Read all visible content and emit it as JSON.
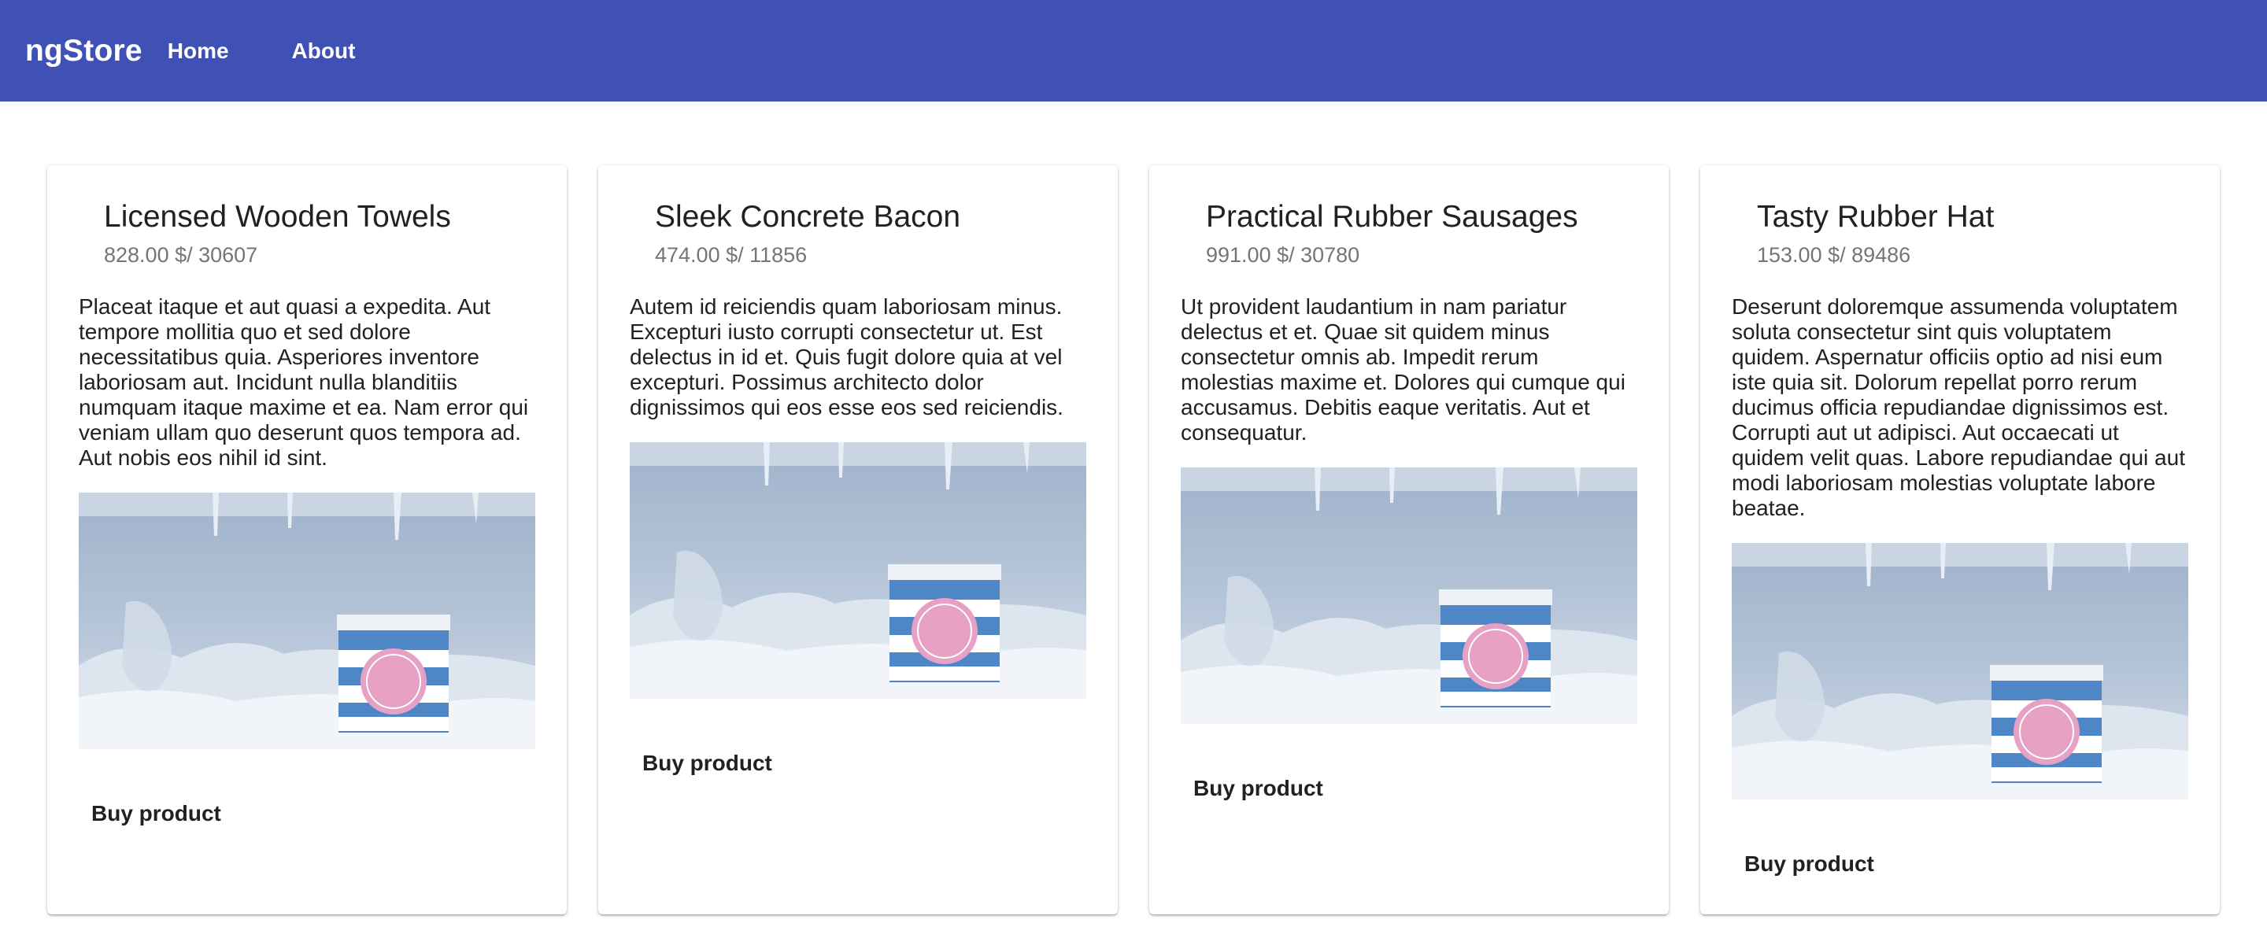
{
  "header": {
    "brand": "ngStore",
    "nav": [
      {
        "label": "Home"
      },
      {
        "label": "About"
      }
    ],
    "color": "#3f51b5"
  },
  "products": [
    {
      "title": "Licensed Wooden Towels",
      "price_line": "828.00 $/ 30607",
      "description": "Placeat itaque et aut quasi a expedita. Aut tempore mollitia quo et sed dolore necessitatibus quia. Asperiores inventore laboriosam aut. Incidunt nulla blanditiis numquam itaque maxime et ea. Nam error qui veniam ullam quo deserunt quos tempora ad. Aut nobis eos nihil id sint.",
      "buy_label": "Buy product",
      "image": "ice-cream-tub-in-freezer"
    },
    {
      "title": "Sleek Concrete Bacon",
      "price_line": "474.00 $/ 11856",
      "description": "Autem id reiciendis quam laboriosam minus. Excepturi iusto corrupti consectetur ut. Est delectus in id et. Quis fugit dolore quia at vel excepturi. Possimus architecto dolor dignissimos qui eos esse eos sed reiciendis.",
      "buy_label": "Buy product",
      "image": "ice-cream-tub-in-freezer"
    },
    {
      "title": "Practical Rubber Sausages",
      "price_line": "991.00 $/ 30780",
      "description": "Ut provident laudantium in nam pariatur delectus et et. Quae sit quidem minus consectetur omnis ab. Impedit rerum molestias maxime et. Dolores qui cumque qui accusamus. Debitis eaque veritatis. Aut et consequatur.",
      "buy_label": "Buy product",
      "image": "ice-cream-tub-in-freezer"
    },
    {
      "title": "Tasty Rubber Hat",
      "price_line": "153.00 $/ 89486",
      "description": "Deserunt doloremque assumenda voluptatem soluta consectetur sint quis voluptatem quidem. Aspernatur officiis optio ad nisi eum iste quia sit. Dolorum repellat porro rerum ducimus officia repudiandae dignissimos est. Corrupti aut ut adipisci. Aut occaecati ut quidem velit quas. Labore repudiandae qui aut modi laboriosam molestias voluptate labore beatae.",
      "buy_label": "Buy product",
      "image": "ice-cream-tub-in-freezer"
    }
  ]
}
